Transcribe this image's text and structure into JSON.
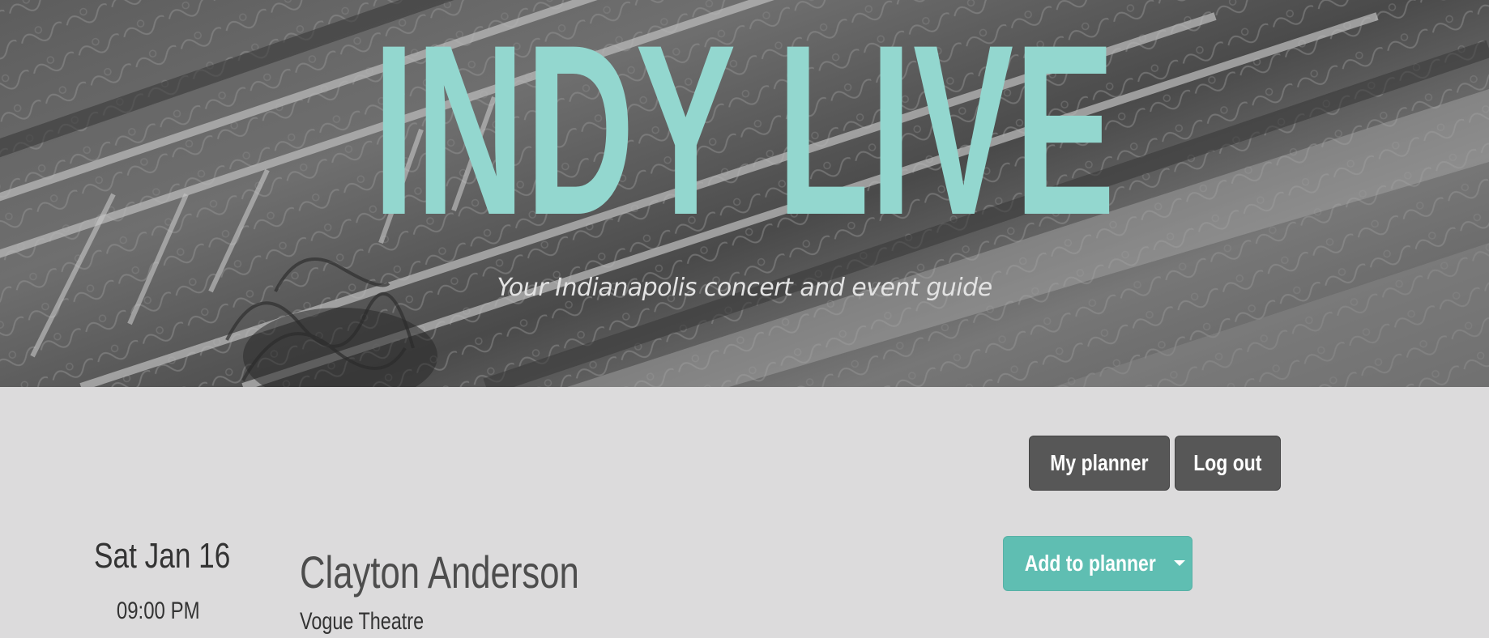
{
  "hero": {
    "title": "INDY LIVE",
    "subtitle": "Your Indianapolis concert and event guide"
  },
  "nav": {
    "my_planner_label": "My planner",
    "log_out_label": "Log out"
  },
  "event": {
    "date": "Sat Jan 16",
    "time": "09:00 PM",
    "name": "Clayton Anderson",
    "venue": "Vogue Theatre",
    "add_to_planner_label": "Add to planner"
  },
  "colors": {
    "accent_teal": "#93d7cf",
    "button_teal": "#5fbeb2",
    "button_dark": "#575757",
    "page_background": "#dcdbdc"
  }
}
